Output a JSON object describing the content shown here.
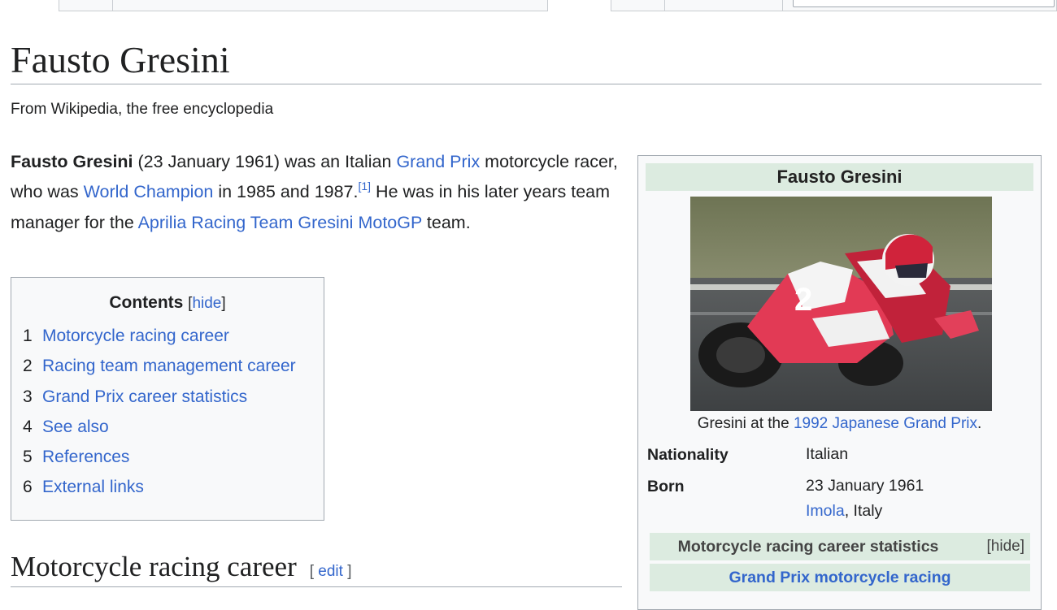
{
  "title": "Fausto Gresini",
  "tagline": "From Wikipedia, the free encyclopedia",
  "lead": {
    "bold_name": "Fausto Gresini",
    "t1": " (23 January 1961) was an Italian ",
    "link_gp": "Grand Prix",
    "t2": " motorcycle racer, who was ",
    "link_wc": "World Champion",
    "t3": " in 1985 and 1987.",
    "ref1": "[1]",
    "t4": " He was in his later years team manager for the ",
    "link_team": "Aprilia Racing Team Gresini",
    "t5": " ",
    "link_motogp": "MotoGP",
    "t6": " team."
  },
  "toc": {
    "title": "Contents",
    "hide_open": "[",
    "hide_label": "hide",
    "hide_close": "]",
    "items": [
      {
        "num": "1",
        "label": "Motorcycle racing career"
      },
      {
        "num": "2",
        "label": "Racing team management career"
      },
      {
        "num": "3",
        "label": "Grand Prix career statistics"
      },
      {
        "num": "4",
        "label": "See also"
      },
      {
        "num": "5",
        "label": "References"
      },
      {
        "num": "6",
        "label": "External links"
      }
    ]
  },
  "section": {
    "heading": "Motorcycle racing career",
    "edit_open": "[",
    "edit_label": "edit",
    "edit_close": "]"
  },
  "infobox": {
    "header": "Fausto Gresini",
    "caption_pre": "Gresini at the ",
    "caption_link": "1992 Japanese Grand Prix",
    "caption_post": ".",
    "nationality_label": "Nationality",
    "nationality_value": "Italian",
    "born_label": "Born",
    "born_date": "23 January 1961",
    "born_place_link": "Imola",
    "born_place_rest": ", Italy",
    "stats_header": "Motorcycle racing career statistics",
    "stats_hide": "[hide]",
    "gp_racing_link": "Grand Prix motorcycle racing"
  },
  "colors": {
    "link": "#3366cc",
    "infobox_header_bg": "#dcebe0",
    "panel_bg": "#f8f9fa",
    "border": "#a2a9b1"
  }
}
